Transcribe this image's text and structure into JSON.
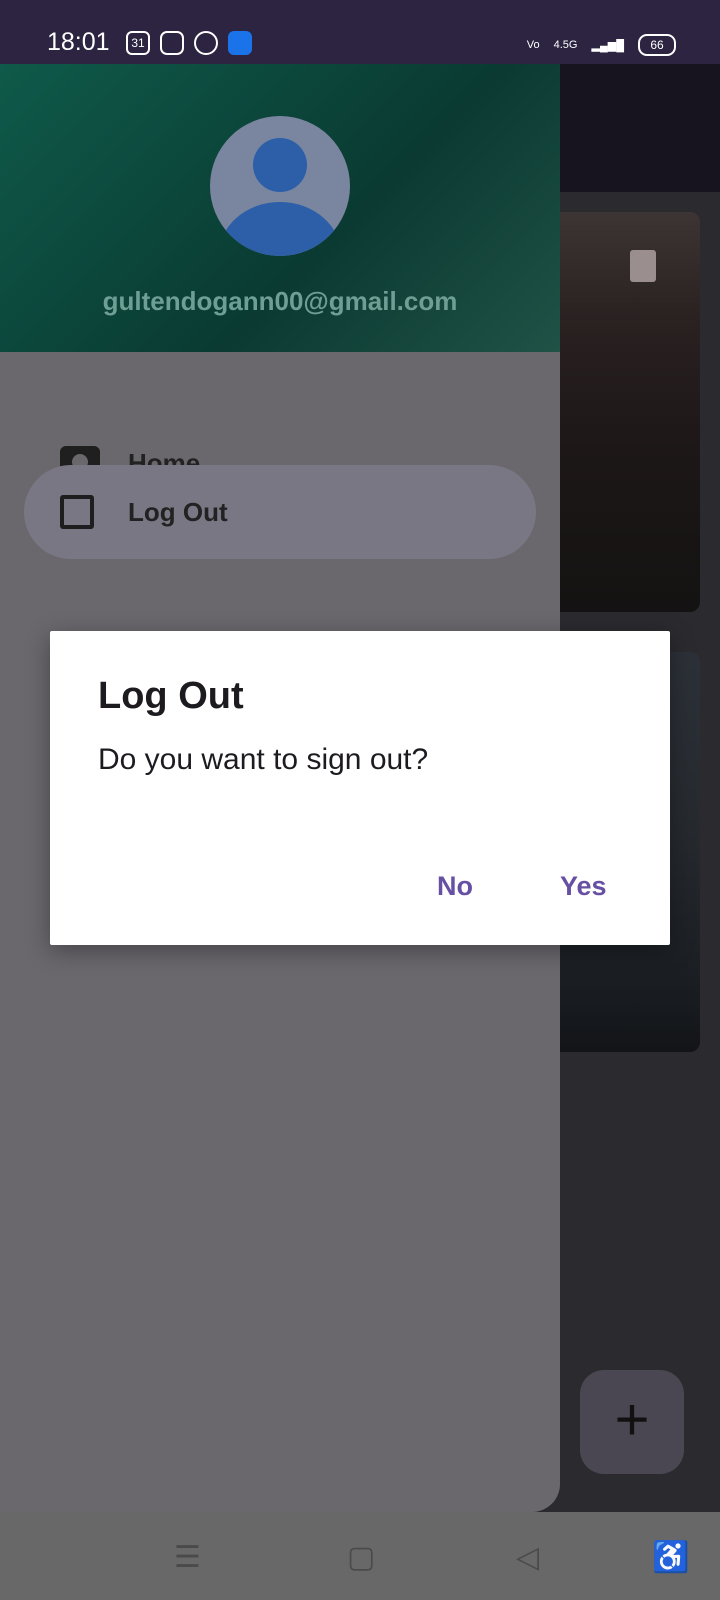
{
  "status_bar": {
    "time": "18:01",
    "calendar_day": "31",
    "battery": "66",
    "network": "4.5G"
  },
  "drawer": {
    "email": "gultendogann00@gmail.com",
    "items": [
      {
        "label": "Home",
        "icon": "camera-icon"
      },
      {
        "label": "Log Out",
        "icon": "exit-icon"
      }
    ]
  },
  "dialog": {
    "title": "Log Out",
    "message": "Do you want to sign out?",
    "no_label": "No",
    "yes_label": "Yes"
  },
  "fab": {
    "label": "+"
  },
  "colors": {
    "accent": "#6750a4",
    "drawer_header": "#0a3a32"
  }
}
